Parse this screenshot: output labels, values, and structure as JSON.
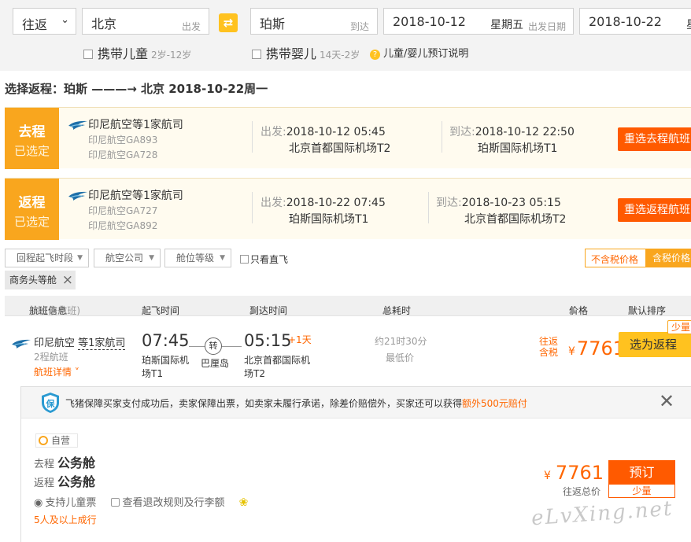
{
  "search": {
    "trip_type": "往返",
    "from_city": "北京",
    "from_hint": "出发",
    "to_city": "珀斯",
    "to_hint": "到达",
    "depart_date": "2018-10-12",
    "depart_weekday": "星期五",
    "depart_date_hint": "出发日期",
    "return_date": "2018-10-22",
    "return_weekday_partial": "星",
    "child_label": "携带儿童",
    "child_age": "2岁-12岁",
    "infant_label": "携带婴儿",
    "infant_age": "14天-2岁",
    "help_label": "儿童/婴儿预订说明"
  },
  "section_title": "选择返程：珀斯 ———→ 北京  2018-10-22周一",
  "trips": [
    {
      "tag_top": "去程",
      "tag_bottom": "已选定",
      "airline": "印尼航空等1家航司",
      "flight1": "印尼航空GA893",
      "flight2": "印尼航空GA728",
      "dep_label": "出发:",
      "dep_time": "2018-10-12 05:45",
      "dep_airport": "北京首都国际机场T2",
      "arr_label": "到达:",
      "arr_time": "2018-10-12 22:50",
      "arr_airport": "珀斯国际机场T1",
      "rechoose": "重选去程航班"
    },
    {
      "tag_top": "返程",
      "tag_bottom": "已选定",
      "airline": "印尼航空等1家航司",
      "flight1": "印尼航空GA727",
      "flight2": "印尼航空GA892",
      "dep_label": "出发:",
      "dep_time": "2018-10-22 07:45",
      "dep_airport": "珀斯国际机场T1",
      "arr_label": "到达:",
      "arr_time": "2018-10-23 05:15",
      "arr_airport": "北京首都国际机场T2",
      "rechoose": "重选返程航班"
    }
  ],
  "filters": {
    "dep_time": "回程起飞时段",
    "airline": "航空公司",
    "cabin": "舱位等级",
    "direct_only": "只看直飞",
    "price_excl": "不含税价格",
    "price_incl": "含税价格",
    "chip": "商务头等舱"
  },
  "table_head": {
    "flight_info": "航班信息",
    "flight_count": "(共1条航班)",
    "dep_time": "起飞时间",
    "arr_time": "到达时间",
    "duration": "总耗时",
    "price": "价格",
    "sort": "默认排序"
  },
  "flight": {
    "airline": "印尼航空",
    "airline_more": "等1家航司",
    "legs": "2程航班",
    "details": "航班详情",
    "dep_time": "07:45",
    "dep_airport_l1": "珀斯国际机",
    "dep_airport_l2": "场T1",
    "transfer": "转",
    "transfer_city": "巴厘岛",
    "arr_time": "05:15",
    "plus_day": "+1天",
    "arr_airport_l1": "北京首都国际机",
    "arr_airport_l2": "场T2",
    "duration": "约21时30分",
    "lowest": "最低价",
    "round_trip": "往返",
    "tax_incl": "含税",
    "currency": "¥",
    "price": "7761",
    "select_btn": "选为返程",
    "few": "少量"
  },
  "detail": {
    "guarantee_text": "飞猪保障买家支付成功后，卖家保障出票，如卖家未履行承诺，除差价赔偿外，买家还可以获得",
    "guarantee_highlight": "额外500元赔付",
    "self_op": "自营",
    "out_label": "去程",
    "out_cabin": "公务舱",
    "ret_label": "返程",
    "ret_cabin": "公务舱",
    "child_ticket": "支持儿童票",
    "rules": "查看退改规则及行李额",
    "min_pax": "5人及以上成行",
    "currency": "¥",
    "price": "7761",
    "total_label": "往返总价",
    "book": "预订",
    "few": "少量"
  },
  "watermark": "eLvXing.net",
  "colors": {
    "accent_orange": "#ff5a00",
    "tag_orange": "#f9a61e",
    "price_orange": "#ff6600",
    "yellow": "#ffc21f"
  }
}
